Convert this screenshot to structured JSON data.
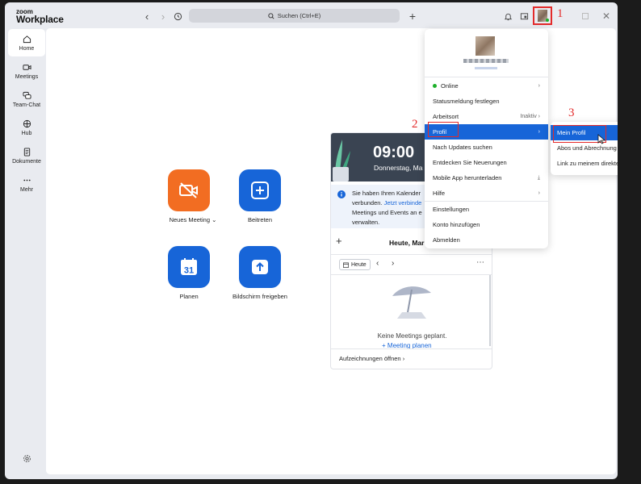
{
  "app": {
    "logo_small": "zoom",
    "logo_big": "Workplace"
  },
  "titlebar": {
    "search_placeholder": "Suchen (Ctrl+E)"
  },
  "sidebar": {
    "items": [
      {
        "label": "Home"
      },
      {
        "label": "Meetings"
      },
      {
        "label": "Team-Chat"
      },
      {
        "label": "Hub"
      },
      {
        "label": "Dokumente"
      },
      {
        "label": "Mehr"
      }
    ]
  },
  "actions": {
    "new_meeting": "Neues Meeting",
    "join": "Beitreten",
    "schedule": "Planen",
    "schedule_day": "31",
    "share_screen": "Bildschirm freigeben"
  },
  "calendar": {
    "time": "09:00",
    "date": "Donnerstag, Ma",
    "info_l1": "Sie haben Ihren Kalender",
    "info_l2a": "verbunden.",
    "info_l2b": "Jetzt verbinde",
    "info_l3": "Meetings und Events an e",
    "info_l4": "verwalten.",
    "today_heading": "Heute, Mar",
    "today_button": "Heute",
    "empty_text": "Keine Meetings geplant.",
    "plan_link": "Meeting planen",
    "recordings": "Aufzeichnungen öffnen"
  },
  "menu": {
    "status": "Online",
    "status_color": "#1db02a",
    "items": [
      "Statusmeldung festlegen",
      "Arbeitsort",
      "Profil",
      "Nach Updates suchen",
      "Entdecken Sie Neuerungen",
      "Mobile App herunterladen",
      "Hilfe",
      "Einstellungen",
      "Konto hinzufügen",
      "Abmelden"
    ],
    "arbeitsort_value": "Inaktiv"
  },
  "submenu": {
    "items": [
      "Mein Profil",
      "Abos und Abrechnung",
      "Link zu meinem direkte..."
    ]
  },
  "steps": {
    "s1": "1",
    "s2": "2",
    "s3": "3"
  },
  "colors": {
    "accent": "#1765d8",
    "new_meeting": "#f26d22",
    "annotation": "#e32a2a"
  }
}
